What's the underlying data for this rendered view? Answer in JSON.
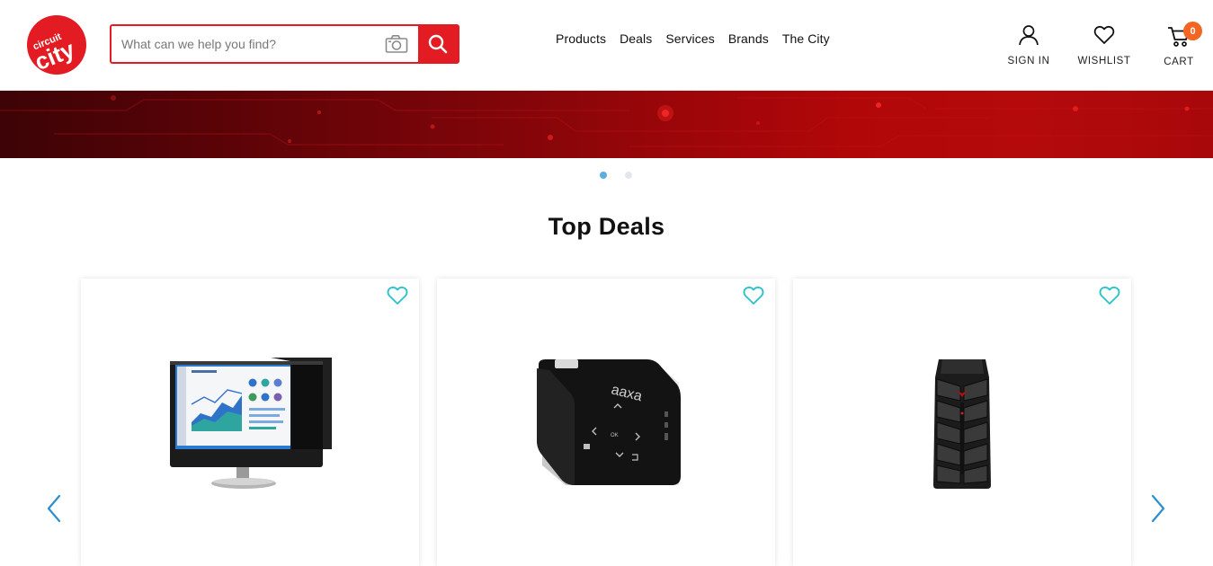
{
  "brand": {
    "name": "circuit city",
    "accent": "#e31c23"
  },
  "search": {
    "placeholder": "What can we help you find?",
    "value": ""
  },
  "nav": {
    "items": [
      "Products",
      "Deals",
      "Services",
      "Brands",
      "The City"
    ]
  },
  "header_actions": {
    "sign_in": "SIGN IN",
    "wishlist": "WISHLIST",
    "cart": "CART",
    "cart_count": "0"
  },
  "hero": {
    "slide_count": 2,
    "active_slide": 1
  },
  "top_deals": {
    "title": "Top Deals",
    "products": [
      {
        "image": "monitor-privacy-filter-image",
        "favorite_icon": "heart-outline-icon"
      },
      {
        "image": "pico-projector-image",
        "favorite_icon": "heart-outline-icon"
      },
      {
        "image": "gaming-tower-pc-image",
        "favorite_icon": "heart-outline-icon"
      }
    ]
  },
  "colors": {
    "wish_heart": "#29c4c9",
    "carousel_arrow": "#2a8fd0",
    "badge": "#f26522",
    "active_dot": "#5aaee0"
  }
}
